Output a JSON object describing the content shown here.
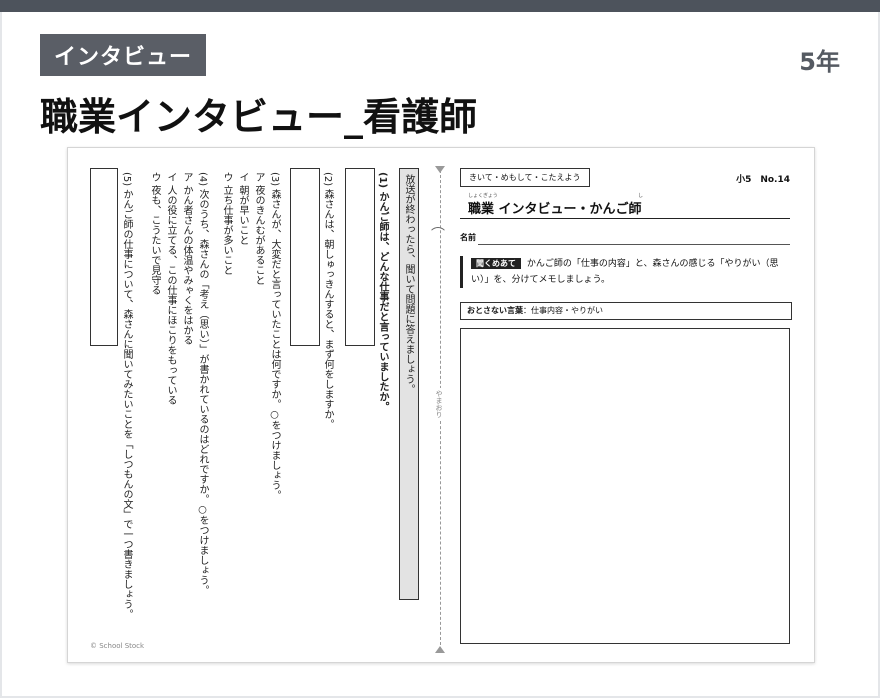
{
  "header": {
    "badge": "インタビュー",
    "grade": "5年",
    "title": "職業インタビュー_看護師"
  },
  "worksheet": {
    "copyright": "© School Stock",
    "left": {
      "instruction": "放送が終わったら、聞いて問題に答えましょう。",
      "q1": "(1) かんご師は、どんな仕事だと言っていましたか。",
      "q2": "(2) 森さんは、朝しゅっきんすると、まず何をしますか。",
      "q3": "(3) 森さんが、大変だと言っていたことは何ですか。○をつけましょう。",
      "q3_options": [
        "ア 夜のきんむがあること",
        "イ 朝が早いこと",
        "ウ 立ち仕事が多いこと"
      ],
      "q4": "(4) 次のうち、森さんの「考え（思い）」が書かれているのはどれですか。○をつけましょう。",
      "q4_options": [
        "ア かん者さんの体温やみゃくをはかる",
        "イ 人の役に立てる、この仕事にほこりをもっている",
        "ウ 夜も、こうたいで見守る"
      ],
      "q5": "(5) かんご師の仕事について、森さんに聞いてみたいことを「しつもんの文」で一つ書きましょう。",
      "fold_label": "やまおり"
    },
    "right": {
      "tag": "きいて・めもして・こたえよう",
      "sheet_number": "小5　No.14",
      "title": "職業 インタビュー・かんご師",
      "title_ruby_1": "しょくぎょう",
      "title_ruby_2": "し",
      "name_label": "名前",
      "prompt_label": "聞くめあて",
      "prompt_text": "かんご師の「仕事の内容」と、森さんの感じる「やりがい（思い）」を、分けてメモしましょう。",
      "kotoba_label": "おとさない言葉",
      "kotoba_text": "：仕事内容・やりがい"
    }
  }
}
